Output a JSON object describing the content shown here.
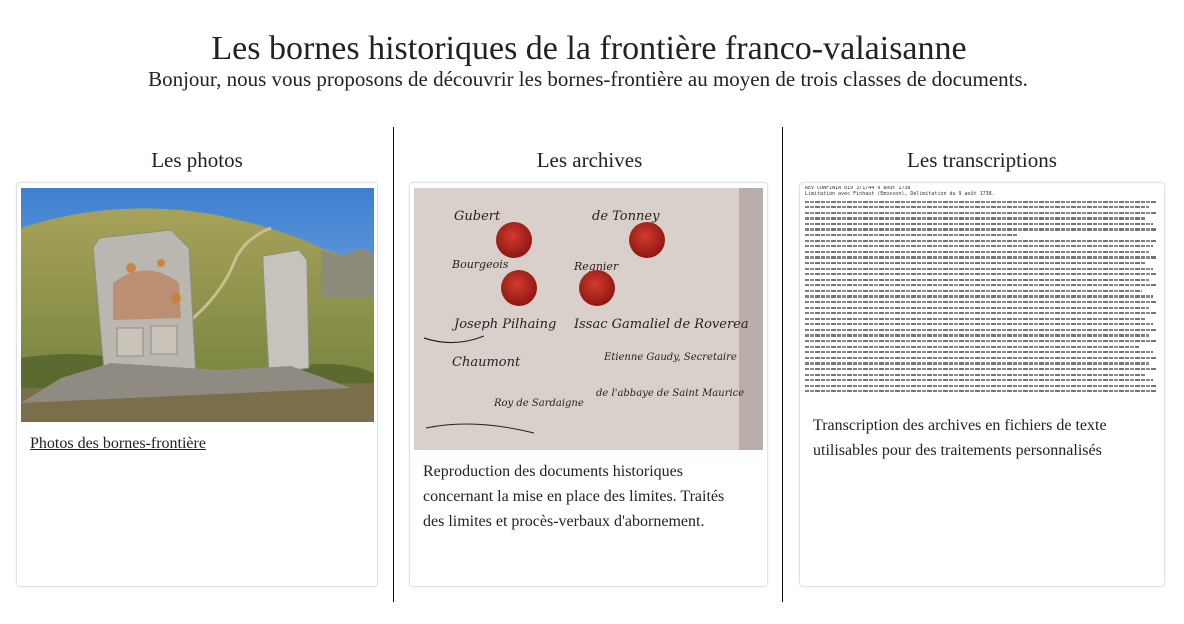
{
  "page": {
    "title": "Les bornes historiques de la frontière franco-valaisanne",
    "intro": "Bonjour, nous vous proposons de découvrir les bornes-frontière au moyen de trois classes de documents."
  },
  "columns": [
    {
      "title": "Les photos",
      "link_text": "Photos des bornes-frontière",
      "image_icon": "boundary-stones-photo"
    },
    {
      "title": "Les archives",
      "description": "Reproduction des documents historiques concernant la mise en place des limites. Traités des limites et procès-verbaux d'abornement.",
      "image_icon": "archive-document-photo",
      "doc_words": {
        "w1": "Gubert",
        "w2": "de Tonney",
        "w3": "Bourgeois",
        "w4": "Regnier",
        "w5": "Joseph Pilhaing",
        "w6": "Issac Gamaliel de Roverea",
        "w7": "Chaumont",
        "w8": "Etienne Gaudy, Secretaire",
        "w9": "de l'abbaye de Saint Maurice",
        "w10": "Roy de Sardaigne"
      }
    },
    {
      "title": "Les transcriptions",
      "description": "Transcription des archives en fichiers de texte utilisables pour des traitements personnalisés",
      "image_icon": "transcription-text-preview",
      "doc_header_1": "REV CONFINIA 019 3/1/44  9 août 1738",
      "doc_header_2": "Limitation avec Finhaut (Emosson), Délimitation du 9 août 1738."
    }
  ],
  "colors": {
    "text": "#222222",
    "border": "#e3e3e3",
    "divider": "#111111",
    "seal_red": "#b3201c",
    "sky": "#6a9fd6",
    "grass": "#8a9a4a"
  }
}
